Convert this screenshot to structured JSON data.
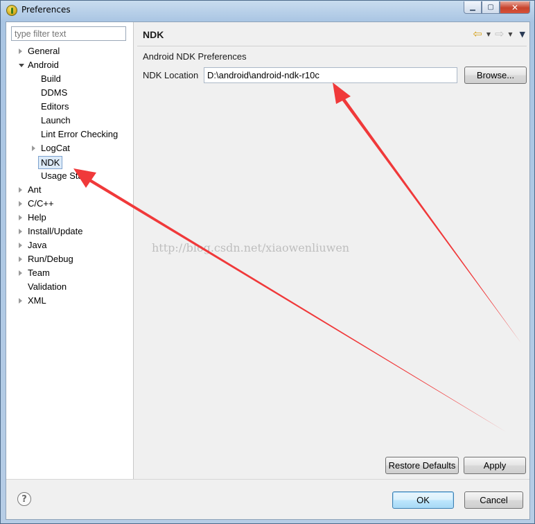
{
  "window": {
    "title": "Preferences",
    "minimize": "▁",
    "maximize": "▢",
    "close": "✕"
  },
  "filter": {
    "placeholder": "type filter text"
  },
  "tree": {
    "general": "General",
    "android": "Android",
    "build": "Build",
    "ddms": "DDMS",
    "editors": "Editors",
    "launch": "Launch",
    "lint": "Lint Error Checking",
    "logcat": "LogCat",
    "ndk": "NDK",
    "usage": "Usage Stat",
    "ant": "Ant",
    "ccpp": "C/C++",
    "help": "Help",
    "install": "Install/Update",
    "java": "Java",
    "rundebug": "Run/Debug",
    "team": "Team",
    "validation": "Validation",
    "xml": "XML"
  },
  "page": {
    "title": "NDK",
    "heading": "Android NDK Preferences",
    "ndk_location_label": "NDK Location",
    "ndk_location_value": "D:\\android\\android-ndk-r10c",
    "browse": "Browse...",
    "restore_defaults": "Restore Defaults",
    "apply": "Apply"
  },
  "nav": {
    "back": "⇦",
    "forward": "⇨",
    "dropdown": "▼",
    "menu": "▼"
  },
  "footer": {
    "help": "?",
    "ok": "OK",
    "cancel": "Cancel"
  },
  "watermark": "http://blog.csdn.net/xiaowenliuwen",
  "colors": {
    "arrow": "#f0393a",
    "selection": "#dceaf8",
    "accent": "#3c7fb1"
  }
}
